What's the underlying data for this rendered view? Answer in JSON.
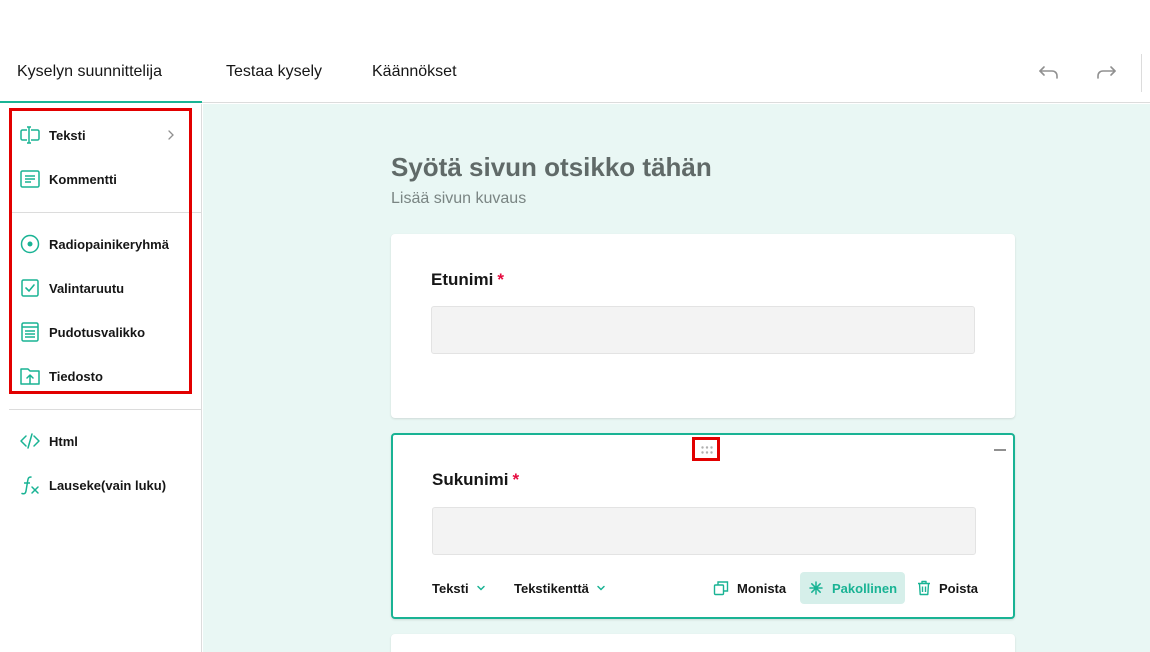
{
  "header": {
    "tabs": [
      {
        "label": "Kyselyn suunnittelija",
        "active": true
      },
      {
        "label": "Testaa kysely",
        "active": false
      },
      {
        "label": "Käännökset",
        "active": false
      }
    ],
    "icons": [
      "undo-icon",
      "redo-icon"
    ]
  },
  "toolbox": {
    "items": [
      {
        "label": "Teksti",
        "icon": "text-input-icon",
        "has_submenu": true
      },
      {
        "label": "Kommentti",
        "icon": "comment-icon"
      },
      {
        "label": "Radiopainikeryhmä",
        "icon": "radio-icon"
      },
      {
        "label": "Valintaruutu",
        "icon": "checkbox-icon"
      },
      {
        "label": "Pudotusvalikko",
        "icon": "dropdown-icon"
      },
      {
        "label": "Tiedosto",
        "icon": "file-upload-icon"
      },
      {
        "label": "Html",
        "icon": "code-icon"
      },
      {
        "label": "Lauseke(vain luku)",
        "icon": "expression-icon"
      }
    ]
  },
  "page": {
    "title": "Syötä sivun otsikko tähän",
    "description": "Lisää sivun kuvaus"
  },
  "questions": [
    {
      "title": "Etunimi",
      "required_mark": "*",
      "value": ""
    },
    {
      "title": "Sukunimi",
      "required_mark": "*",
      "value": ""
    }
  ],
  "question_toolbar": {
    "type_label": "Teksti",
    "subtype_label": "Tekstikenttä",
    "duplicate_label": "Monista",
    "required_label": "Pakollinen",
    "delete_label": "Poista"
  },
  "colors": {
    "accent": "#19b394",
    "required": "#e50a3e",
    "highlight": "#e20000",
    "canvas_bg": "#e9f7f4"
  }
}
